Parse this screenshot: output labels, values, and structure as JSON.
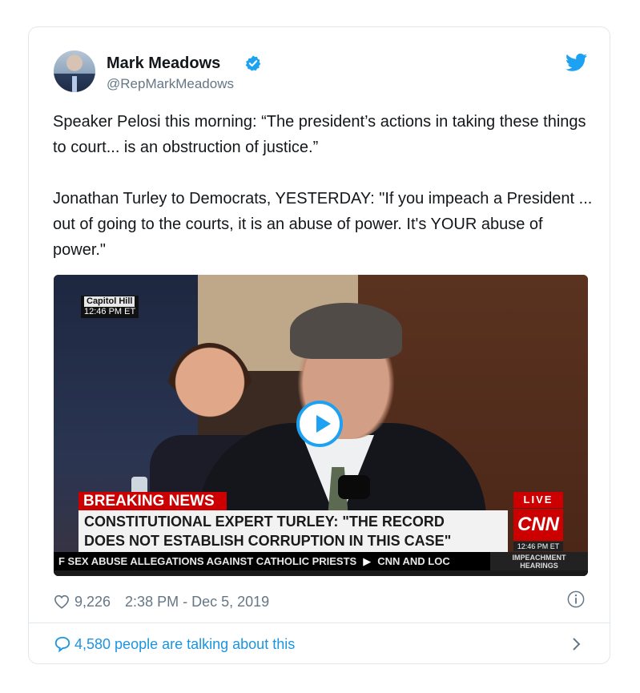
{
  "tweet": {
    "author_name": "Mark Meadows",
    "handle": "@RepMarkMeadows",
    "paragraphs": [
      "Speaker Pelosi this morning: “The president’s actions in taking these things to court... is an obstruction of justice.”",
      "Jonathan Turley to Democrats, YESTERDAY: \"If you impeach a President ... out of going to the courts, it is an abuse of power. It's YOUR abuse of power.\""
    ],
    "likes": "9,226",
    "timestamp": "2:38 PM - Dec 5, 2019",
    "talking": "4,580 people are talking about this"
  },
  "video": {
    "location": "Capitol Hill",
    "location_time": "12:46 PM ET",
    "breaking": "BREAKING NEWS",
    "headline_line1": "CONSTITUTIONAL EXPERT TURLEY: \"THE RECORD",
    "headline_line2": "DOES NOT ESTABLISH CORRUPTION IN THIS CASE\"",
    "live": "LIVE",
    "network": "CNN",
    "network_time": "12:46 PM ET",
    "ticker_left": "F SEX ABUSE ALLEGATIONS AGAINST CATHOLIC PRIESTS",
    "ticker_right": "CNN AND LOC",
    "program_line1": "IMPEACHMENT",
    "program_line2": "HEARINGS"
  },
  "icons": {
    "avatar": "avatar",
    "verified": "verified-badge-icon",
    "brand": "twitter-bird-icon",
    "play": "play-icon",
    "like": "heart-icon",
    "info": "info-icon",
    "comment": "speech-bubble-icon",
    "chevron": "chevron-right-icon"
  },
  "colors": {
    "twitter_blue": "#1da1f2",
    "link_blue": "#1b95e0",
    "text": "#14171a",
    "muted": "#657786",
    "cnn_red": "#cc0000"
  }
}
